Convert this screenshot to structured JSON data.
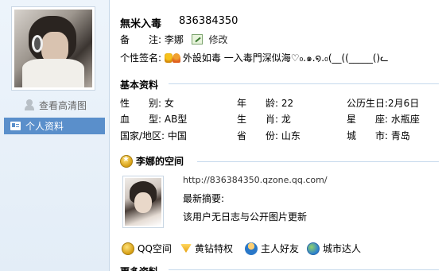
{
  "sidebar": {
    "hd_link": "查看高清图",
    "nav_active": "个人资料"
  },
  "profile": {
    "nickname": "無米入毒",
    "qq_number": "836384350",
    "remark_label": "备　　注:",
    "remark_value": "李娜",
    "edit_label": "修改",
    "signature_label": "个性签名:",
    "signature_value": "外設如毒 一入毒門深似海♡₀.๑.໑.₀(__((_____()ᓚ"
  },
  "basic": {
    "title": "基本资料",
    "rows": [
      [
        {
          "label": "性　　别:",
          "value": "女"
        },
        {
          "label": "年　　龄:",
          "value": "22"
        },
        {
          "label": "公历生日:",
          "value": "2月6日"
        }
      ],
      [
        {
          "label": "血　　型:",
          "value": "AB型"
        },
        {
          "label": "生　　肖:",
          "value": "龙"
        },
        {
          "label": "星　　座:",
          "value": "水瓶座"
        }
      ],
      [
        {
          "label": "国家/地区:",
          "value": "中国"
        },
        {
          "label": "省　　份:",
          "value": "山东"
        },
        {
          "label": "城　　市:",
          "value": "青岛"
        }
      ]
    ]
  },
  "zone": {
    "title": "李娜的空间",
    "url": "http://836384350.qzone.qq.com/",
    "latest_label": "最新摘要:",
    "latest_text": "该用户无日志与公开图片更新"
  },
  "bottom_links": [
    {
      "label": "QQ空间",
      "icon": "qzone-icon"
    },
    {
      "label": "黄钻特权",
      "icon": "yellow-diamond-icon"
    },
    {
      "label": "主人好友",
      "icon": "friends-icon"
    },
    {
      "label": "城市达人",
      "icon": "city-icon"
    }
  ],
  "more": {
    "title": "更多资料"
  }
}
